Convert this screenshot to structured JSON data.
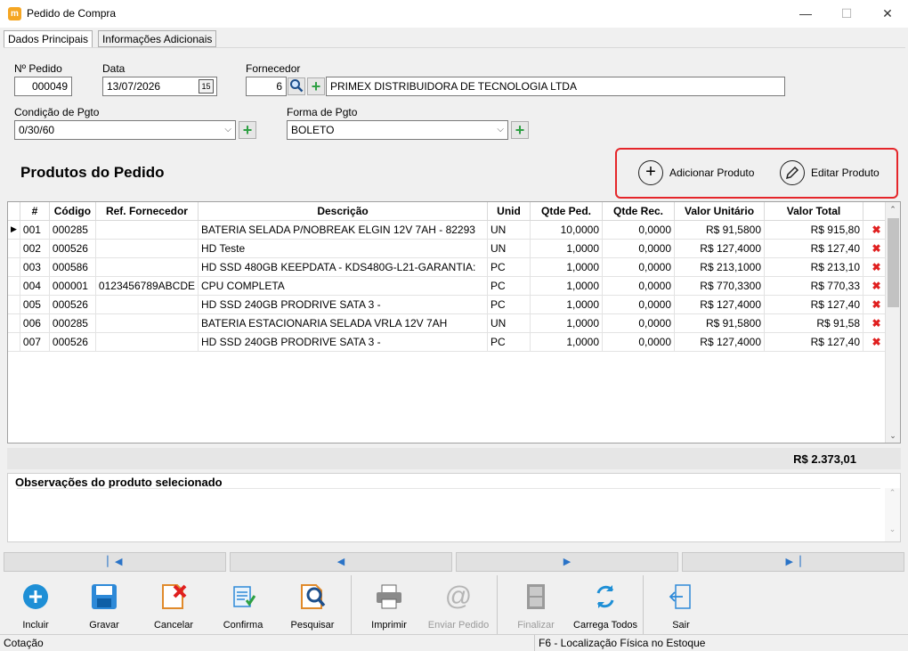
{
  "window": {
    "title": "Pedido de Compra",
    "app_icon_letter": "m",
    "minimize": "—",
    "maximize": "☐",
    "close": "✕"
  },
  "tabs": [
    {
      "label": "Dados Principais",
      "active": true
    },
    {
      "label": "Informações Adicionais",
      "active": false
    }
  ],
  "form": {
    "pedido_label": "Nº Pedido",
    "pedido_value": "000049",
    "data_label": "Data",
    "data_value": "13/07/2026",
    "fornecedor_label": "Fornecedor",
    "fornecedor_code": "6",
    "fornecedor_name": "PRIMEX DISTRIBUIDORA DE TECNOLOGIA LTDA",
    "cond_label": "Condição de Pgto",
    "cond_value": "0/30/60",
    "forma_label": "Forma de Pgto",
    "forma_value": "BOLETO"
  },
  "products_section": {
    "title": "Produtos do Pedido",
    "add_label": "Adicionar Produto",
    "edit_label": "Editar Produto"
  },
  "grid": {
    "columns": [
      "#",
      "Código",
      "Ref. Fornecedor",
      "Descrição",
      "Unid",
      "Qtde Ped.",
      "Qtde Rec.",
      "Valor Unitário",
      "Valor Total"
    ],
    "rows": [
      [
        "001",
        "000285",
        "",
        "BATERIA SELADA P/NOBREAK ELGIN 12V 7AH - 82293",
        "UN",
        "10,0000",
        "0,0000",
        "R$ 91,5800",
        "R$ 915,80"
      ],
      [
        "002",
        "000526",
        "",
        "HD Teste",
        "UN",
        "1,0000",
        "0,0000",
        "R$ 127,4000",
        "R$ 127,40"
      ],
      [
        "003",
        "000586",
        "",
        "HD SSD 480GB KEEPDATA - KDS480G-L21-GARANTIA:",
        "PC",
        "1,0000",
        "0,0000",
        "R$ 213,1000",
        "R$ 213,10"
      ],
      [
        "004",
        "000001",
        "0123456789ABCDE",
        "CPU COMPLETA",
        "PC",
        "1,0000",
        "0,0000",
        "R$ 770,3300",
        "R$ 770,33"
      ],
      [
        "005",
        "000526",
        "",
        "HD SSD 240GB PRODRIVE SATA 3 -",
        "PC",
        "1,0000",
        "0,0000",
        "R$ 127,4000",
        "R$ 127,40"
      ],
      [
        "006",
        "000285",
        "",
        "BATERIA ESTACIONARIA SELADA VRLA 12V 7AH",
        "UN",
        "1,0000",
        "0,0000",
        "R$ 91,5800",
        "R$ 91,58"
      ],
      [
        "007",
        "000526",
        "",
        "HD SSD 240GB PRODRIVE SATA 3 -",
        "PC",
        "1,0000",
        "0,0000",
        "R$ 127,4000",
        "R$ 127,40"
      ]
    ],
    "total": "R$ 2.373,01"
  },
  "observations": {
    "title": "Observações do produto selecionado"
  },
  "toolbar": [
    {
      "label": "Incluir",
      "icon": "plus-circle-icon",
      "enabled": true
    },
    {
      "label": "Gravar",
      "icon": "floppy-icon",
      "enabled": true
    },
    {
      "label": "Cancelar",
      "icon": "cancel-doc-icon",
      "enabled": true
    },
    {
      "label": "Confirma",
      "icon": "confirm-doc-icon",
      "enabled": true
    },
    {
      "label": "Pesquisar",
      "icon": "search-doc-icon",
      "enabled": true
    },
    {
      "label": "Imprimir",
      "icon": "printer-icon",
      "enabled": true
    },
    {
      "label": "Enviar Pedido",
      "icon": "email-icon",
      "enabled": false
    },
    {
      "label": "Finalizar",
      "icon": "cabinet-icon",
      "enabled": false
    },
    {
      "label": "Carrega Todos",
      "icon": "refresh-icon",
      "enabled": true
    },
    {
      "label": "Sair",
      "icon": "exit-icon",
      "enabled": true
    }
  ],
  "statusbar": {
    "left": "Cotação",
    "right": "F6 - Localização Física no Estoque"
  },
  "colors": {
    "accent_blue": "#1e8fd6",
    "delete_red": "#e02020",
    "highlight_red": "#e5262a",
    "add_green": "#2ea043"
  }
}
